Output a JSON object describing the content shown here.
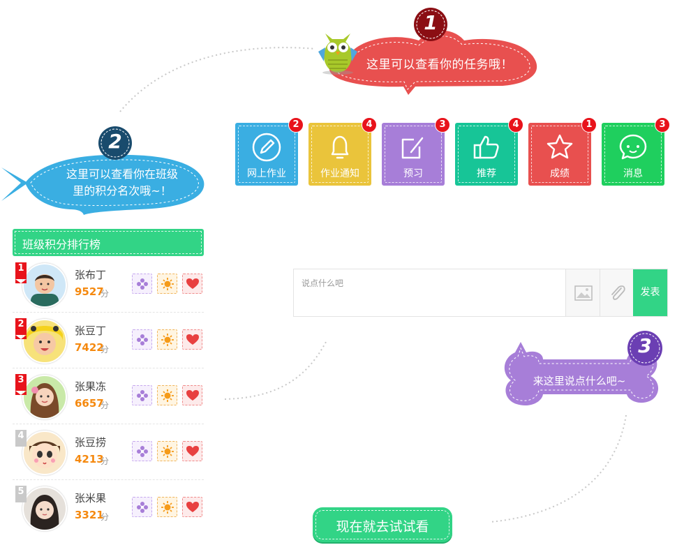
{
  "guide": {
    "step1": {
      "number": "1",
      "text": "这里可以查看你的任务哦！"
    },
    "step2": {
      "number": "2",
      "line1": "这里可以查看你在班级",
      "line2": "里的积分名次哦~！"
    },
    "step3": {
      "number": "3",
      "text": "来这里说点什么吧~"
    }
  },
  "tiles": [
    {
      "label": "网上作业",
      "count": "2",
      "icon": "pencil-icon",
      "color": "#3aaee2"
    },
    {
      "label": "作业通知",
      "count": "4",
      "icon": "bell-icon",
      "color": "#eac43b"
    },
    {
      "label": "预习",
      "count": "3",
      "icon": "edit-icon",
      "color": "#a77ed8"
    },
    {
      "label": "推荐",
      "count": "4",
      "icon": "thumbs-up-icon",
      "color": "#17c597"
    },
    {
      "label": "成绩",
      "count": "1",
      "icon": "star-icon",
      "color": "#e8504f"
    },
    {
      "label": "消息",
      "count": "3",
      "icon": "chat-icon",
      "color": "#1fcf5e"
    }
  ],
  "ranking": {
    "title": "班级积分排行榜",
    "unit": "分",
    "rows": [
      {
        "rank": "1",
        "name": "张布丁",
        "score": "9527"
      },
      {
        "rank": "2",
        "name": "张豆丁",
        "score": "7422"
      },
      {
        "rank": "3",
        "name": "张果冻",
        "score": "6657"
      },
      {
        "rank": "4",
        "name": "张豆捞",
        "score": "4213"
      },
      {
        "rank": "5",
        "name": "张米果",
        "score": "3321"
      }
    ]
  },
  "composer": {
    "placeholder": "说点什么吧",
    "post_label": "发表"
  },
  "cta": {
    "label": "现在就去试试看"
  },
  "colors": {
    "accent_green": "#32d486",
    "callout_red": "#e8504f",
    "callout_blue": "#3aaee2",
    "callout_purple": "#a77ed8",
    "score_orange": "#f5890f"
  }
}
